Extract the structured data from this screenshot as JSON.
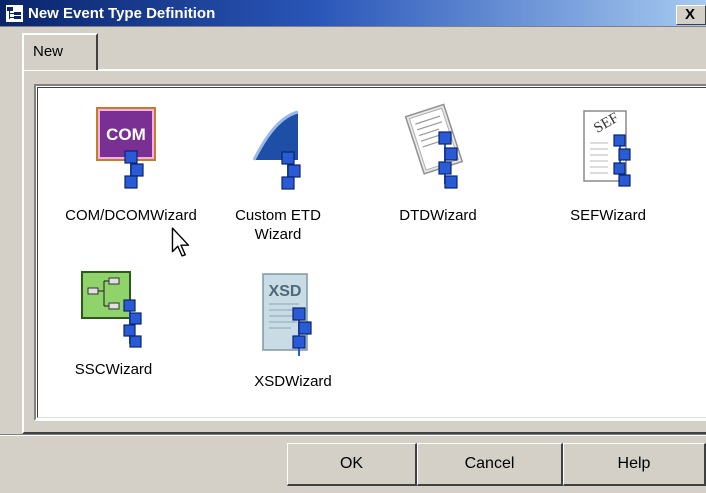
{
  "dialog": {
    "title": "New Event Type Definition",
    "close_label": "X"
  },
  "tabs": [
    {
      "label": "New",
      "selected": true
    }
  ],
  "wizards": [
    {
      "label": "COM/DCOMWizard",
      "icon": "com-wizard-icon"
    },
    {
      "label": "Custom ETD\nWizard",
      "icon": "custom-etd-wizard-icon"
    },
    {
      "label": "DTDWizard",
      "icon": "dtd-wizard-icon"
    },
    {
      "label": "SEFWizard",
      "icon": "sef-wizard-icon"
    },
    {
      "label": "SSCWizard",
      "icon": "ssc-wizard-icon"
    },
    {
      "label": "XSDWizard",
      "icon": "xsd-wizard-icon"
    }
  ],
  "icon_text": {
    "com": "COM",
    "xsd": "XSD",
    "sef": "SEF"
  },
  "buttons": {
    "ok": "OK",
    "cancel": "Cancel",
    "help": "Help"
  },
  "colors": {
    "titlebar_start": "#0a246a",
    "titlebar_end": "#a6caf0",
    "face": "#d4d0c8",
    "com_purple": "#7a2f93",
    "connector_blue": "#2a5bd7",
    "ssc_green": "#8fd46a"
  }
}
